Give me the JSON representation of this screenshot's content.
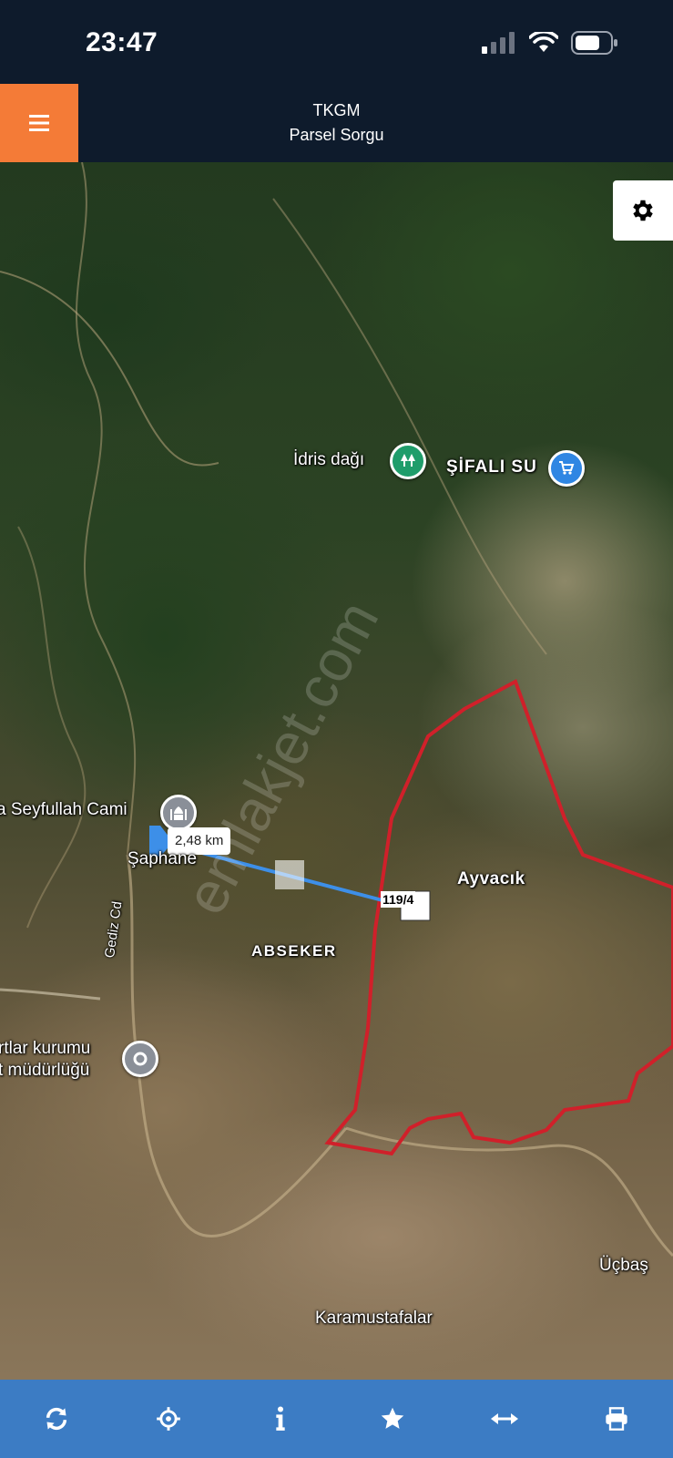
{
  "status_bar": {
    "time": "23:47",
    "icons": [
      "cellular-signal-icon",
      "wifi-icon",
      "battery-icon"
    ]
  },
  "header": {
    "title": "TKGM",
    "subtitle": "Parsel Sorgu",
    "menu_icon": "hamburger-menu-icon",
    "accent_color": "#f47b37",
    "bar_color": "#0e1b2c"
  },
  "map": {
    "labels": {
      "idris_dagi": "İdris dağı",
      "sifali_su": "ŞİFALI SU",
      "seyfullah_cami": "a Seyfullah Cami",
      "saphane": "Şaphane",
      "ayvacik": "Ayvacık",
      "abseker": "ABSEKER",
      "gediz_cd": "Gediz Cd",
      "kurum_line1": "rtlar kurumu",
      "kurum_line2": "t müdürlüğü",
      "ucbas": "Üçbaş",
      "karamustafalar": "Karamustafalar"
    },
    "measurement": {
      "distance": "2,48 km",
      "line_color": "#3d8fe8"
    },
    "parcel": {
      "label": "119/4",
      "outline_color": "#d0202a"
    },
    "watermark": "emlakjet.com",
    "settings_icon": "gear-icon"
  },
  "toolbar": {
    "color": "#3c7cc4",
    "items": [
      {
        "name": "refresh",
        "icon": "refresh-icon"
      },
      {
        "name": "locate",
        "icon": "crosshair-icon"
      },
      {
        "name": "info",
        "icon": "info-icon"
      },
      {
        "name": "favorite",
        "icon": "star-icon"
      },
      {
        "name": "measure",
        "icon": "horizontal-arrows-icon"
      },
      {
        "name": "print",
        "icon": "printer-icon"
      }
    ]
  }
}
